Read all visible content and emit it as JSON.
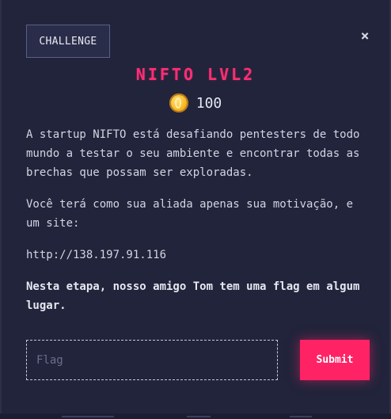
{
  "modal": {
    "tag": "CHALLENGE",
    "close_symbol": "×",
    "title": "NIFTO LVL2",
    "points": "100",
    "paragraphs": {
      "p1": "A startup NIFTO está desafiando pentesters de todo mundo a testar o seu ambiente e encontrar todas as brechas que possam ser exploradas.",
      "p2": "Você terá como sua aliada apenas sua motivação, e um site:",
      "p3": "http://138.197.91.116",
      "p4": "Nesta etapa, nosso amigo Tom tem uma flag em algum lugar."
    },
    "flag_placeholder": "Flag",
    "flag_value": "",
    "submit_label": "Submit"
  },
  "icons": {
    "close": "close-icon",
    "coin": "coin-icon"
  },
  "colors": {
    "accent": "#ff2366",
    "title": "#ff2e74",
    "background": "#21243b"
  }
}
